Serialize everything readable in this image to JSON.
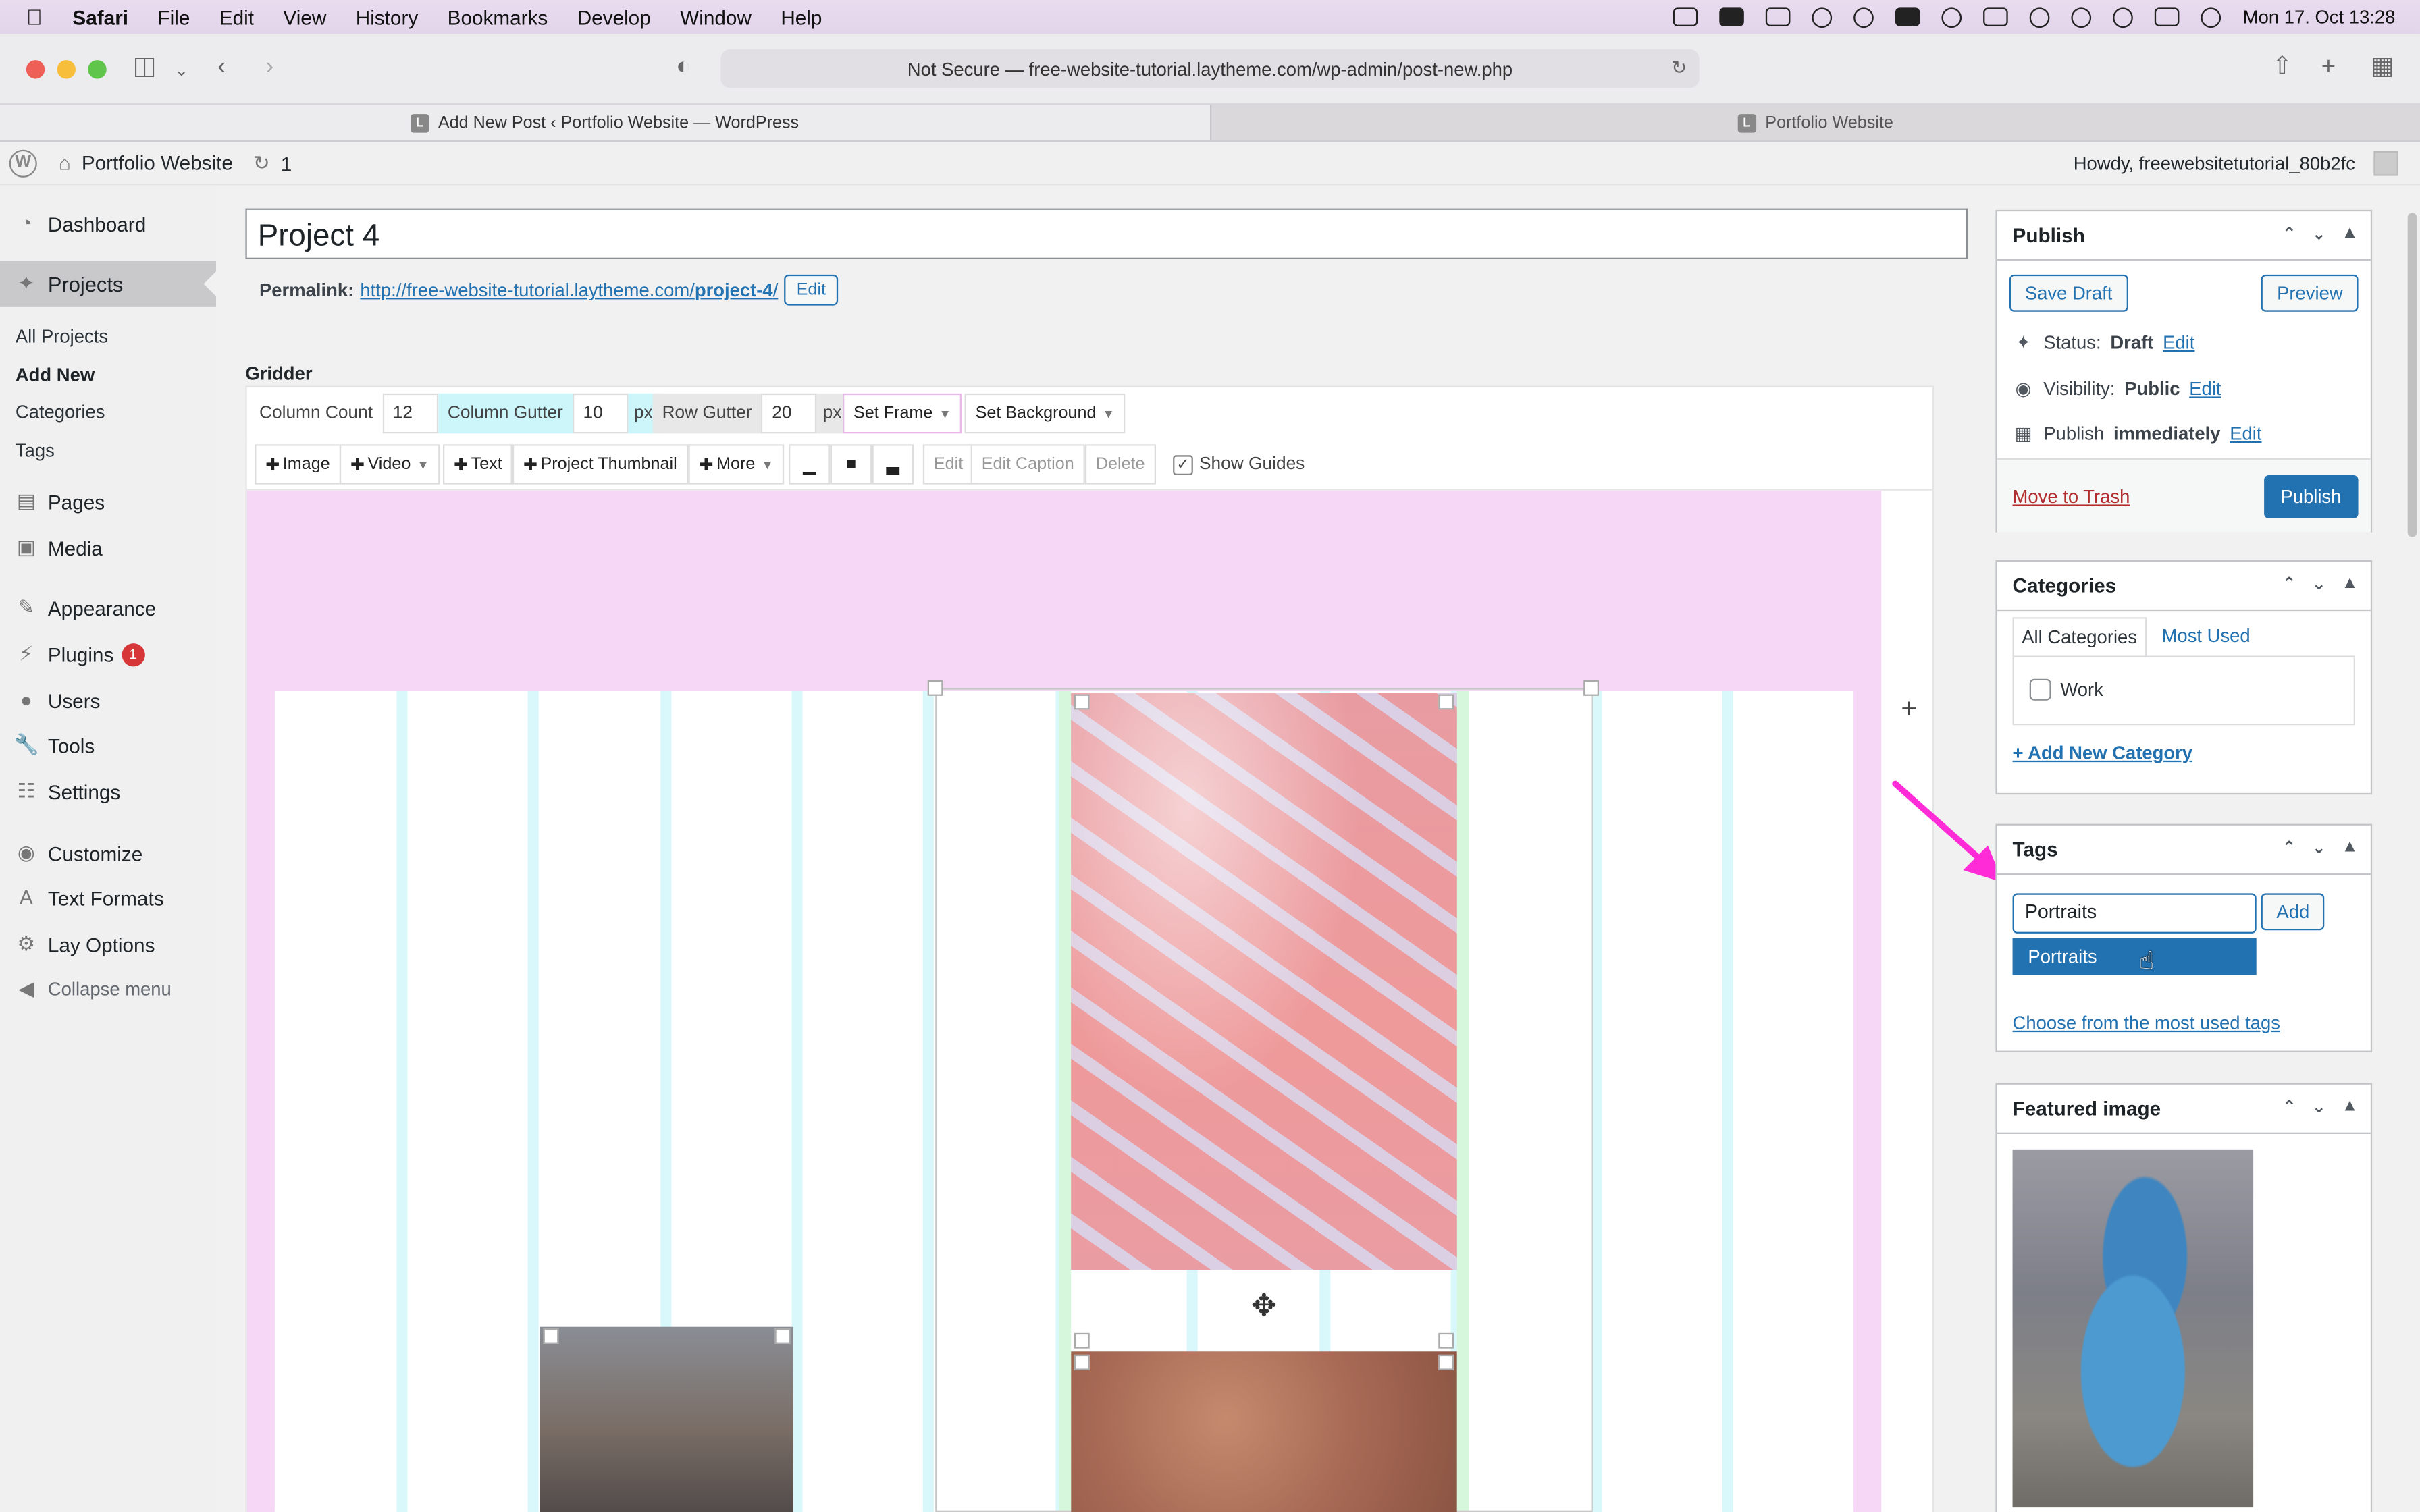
{
  "menubar": {
    "app": "Safari",
    "items": [
      "File",
      "Edit",
      "View",
      "History",
      "Bookmarks",
      "Develop",
      "Window",
      "Help"
    ],
    "clock": "Mon 17. Oct  13:28"
  },
  "browser": {
    "url": "Not Secure — free-website-tutorial.laytheme.com/wp-admin/post-new.php",
    "tabs": [
      {
        "title": "Add New Post ‹ Portfolio Website — WordPress",
        "fav": "L"
      },
      {
        "title": "Portfolio Website",
        "fav": "L"
      }
    ]
  },
  "adminbar": {
    "site": "Portfolio Website",
    "updates": "1",
    "howdy": "Howdy, freewebsitetutorial_80b2fc"
  },
  "sidebar": {
    "dashboard": "Dashboard",
    "projects": "Projects",
    "all_projects": "All Projects",
    "add_new": "Add New",
    "categories": "Categories",
    "tags": "Tags",
    "pages": "Pages",
    "media": "Media",
    "appearance": "Appearance",
    "plugins": "Plugins",
    "plugins_badge": "1",
    "users": "Users",
    "tools": "Tools",
    "settings": "Settings",
    "customize": "Customize",
    "text_formats": "Text Formats",
    "lay_options": "Lay Options",
    "collapse": "Collapse menu"
  },
  "editor": {
    "title": "Project 4",
    "permalink_label": "Permalink:",
    "permalink_base": "http://free-website-tutorial.laytheme.com/",
    "permalink_slug": "project-4",
    "permalink_end": "/",
    "permalink_edit": "Edit"
  },
  "gridder": {
    "label": "Gridder",
    "column_count_label": "Column Count",
    "column_count": "12",
    "column_gutter_label": "Column Gutter",
    "column_gutter": "10",
    "row_gutter_label": "Row Gutter",
    "row_gutter": "20",
    "px": "px",
    "set_frame": "Set Frame",
    "set_background": "Set Background",
    "image": "Image",
    "video": "Video",
    "text": "Text",
    "project_thumbnail": "Project Thumbnail",
    "more": "More",
    "edit": "Edit",
    "edit_caption": "Edit Caption",
    "delete": "Delete",
    "show_guides": "Show Guides"
  },
  "publish": {
    "title": "Publish",
    "save_draft": "Save Draft",
    "preview": "Preview",
    "status_label": "Status:",
    "status_value": "Draft",
    "visibility_label": "Visibility:",
    "visibility_value": "Public",
    "publish_label": "Publish",
    "publish_value": "immediately",
    "edit": "Edit",
    "trash": "Move to Trash",
    "publish_btn": "Publish"
  },
  "categories": {
    "title": "Categories",
    "tab_all": "All Categories",
    "tab_used": "Most Used",
    "items": [
      "Work"
    ],
    "add_new": "+ Add New Category"
  },
  "tags": {
    "title": "Tags",
    "input_value": "Portraits",
    "add_btn": "Add",
    "suggestion": "Portraits",
    "choose": "Choose from the most used tags"
  },
  "featured": {
    "title": "Featured image"
  },
  "colors": {
    "wp_blue": "#2271b1",
    "frame_pink": "#f6d8f6",
    "guide_cyan": "#d8f8fb",
    "arrow_magenta": "#ff2bd6"
  }
}
